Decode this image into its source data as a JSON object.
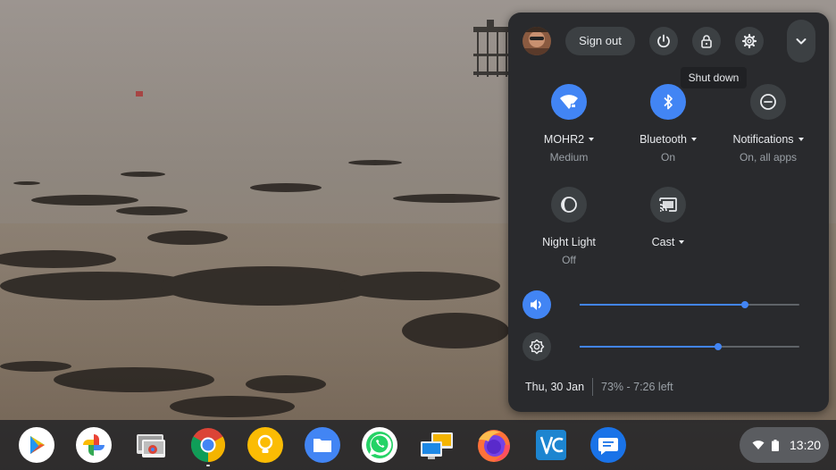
{
  "quick_settings": {
    "sign_out_label": "Sign out",
    "power_icon": "power-icon",
    "lock_icon": "lock-icon",
    "settings_icon": "gear-icon",
    "collapse_icon": "chevron-down-icon",
    "tiles": [
      {
        "id": "network",
        "label": "MOHR2",
        "sublabel": "Medium",
        "state": "on",
        "icon": "wifi-icon"
      },
      {
        "id": "bluetooth",
        "label": "Bluetooth",
        "sublabel": "On",
        "state": "on",
        "icon": "bluetooth-icon"
      },
      {
        "id": "notifications",
        "label": "Notifications",
        "sublabel": "On, all apps",
        "state": "off",
        "icon": "do-not-disturb-icon"
      },
      {
        "id": "night-light",
        "label": "Night Light",
        "sublabel": "Off",
        "state": "off",
        "icon": "night-light-icon"
      },
      {
        "id": "cast",
        "label": "Cast",
        "sublabel": "",
        "state": "off",
        "icon": "cast-icon"
      }
    ],
    "volume": {
      "icon": "volume-icon",
      "level": 0.75
    },
    "brightness": {
      "icon": "brightness-icon",
      "level": 0.63
    },
    "date": "Thu, 30 Jan",
    "battery_status": "73% - 7:26 left"
  },
  "tooltip": {
    "text": "Shut down"
  },
  "shelf": {
    "apps": [
      {
        "name": "play-store-icon"
      },
      {
        "name": "google-photos-icon"
      },
      {
        "name": "chrome-remote-desktop-icon"
      },
      {
        "name": "chrome-icon"
      },
      {
        "name": "keep-icon"
      },
      {
        "name": "files-icon"
      },
      {
        "name": "whatsapp-icon"
      },
      {
        "name": "remote-desktop-icon"
      },
      {
        "name": "firefox-icon"
      },
      {
        "name": "vnc-viewer-icon"
      },
      {
        "name": "messages-icon"
      }
    ],
    "time": "13:20"
  },
  "colors": {
    "accent": "#4285f4",
    "panel_bg": "#292a2d",
    "button_bg": "#3c4043"
  }
}
